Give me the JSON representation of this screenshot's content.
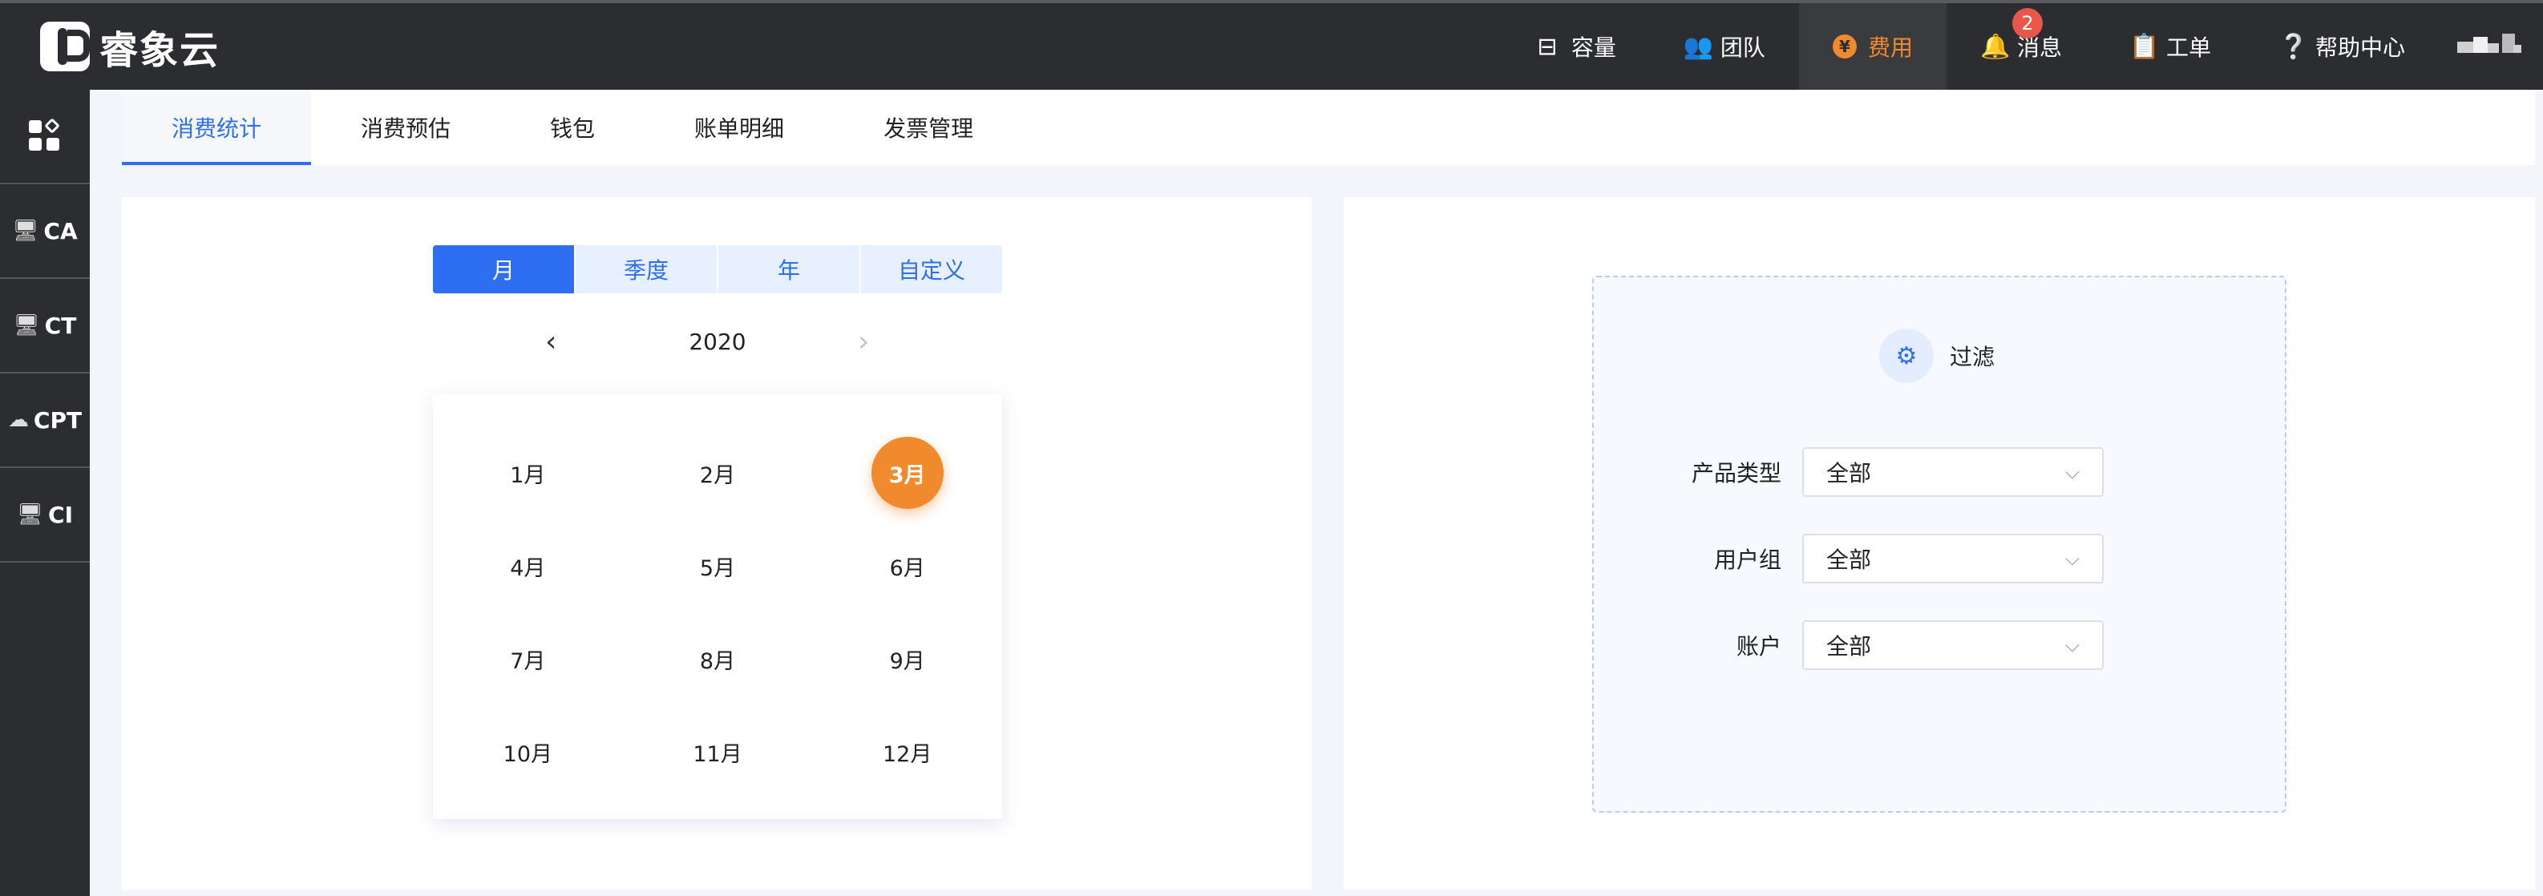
{
  "brand": {
    "name": "睿象云"
  },
  "topnav": {
    "items": [
      {
        "label": "容量",
        "icon": "inbox-icon"
      },
      {
        "label": "团队",
        "icon": "team-icon"
      },
      {
        "label": "费用",
        "icon": "yen-icon",
        "active": true
      },
      {
        "label": "消息",
        "icon": "bell-icon",
        "badge": "2"
      },
      {
        "label": "工单",
        "icon": "clipboard-icon"
      },
      {
        "label": "帮助中心",
        "icon": "help-icon"
      }
    ],
    "yen_glyph": "¥"
  },
  "sidebar": {
    "items": [
      {
        "label": "",
        "icon": "apps-grid-icon"
      },
      {
        "label": "CA",
        "icon": "monitor-icon"
      },
      {
        "label": "CT",
        "icon": "monitor-icon"
      },
      {
        "label": "CPT",
        "icon": "cloud-icon"
      },
      {
        "label": "CI",
        "icon": "monitor-icon"
      }
    ]
  },
  "tabs": [
    {
      "label": "消费统计",
      "active": true
    },
    {
      "label": "消费预估"
    },
    {
      "label": "钱包"
    },
    {
      "label": "账单明细"
    },
    {
      "label": "发票管理"
    }
  ],
  "period": {
    "options": [
      "月",
      "季度",
      "年",
      "自定义"
    ],
    "selected": "月",
    "year": "2020",
    "prev_glyph": "‹",
    "next_glyph": "›"
  },
  "months": {
    "cells": [
      "1月",
      "2月",
      "3月",
      "4月",
      "5月",
      "6月",
      "7月",
      "8月",
      "9月",
      "10月",
      "11月",
      "12月"
    ],
    "selected": "3月"
  },
  "filter": {
    "title": "过滤",
    "rows": [
      {
        "label": "产品类型",
        "value": "全部"
      },
      {
        "label": "用户组",
        "value": "全部"
      },
      {
        "label": "账户",
        "value": "全部"
      }
    ]
  },
  "colors": {
    "accent": "#2d6ff0",
    "selected_month": "#f08a2c",
    "topbar": "#2c2d30",
    "badge": "#e8574a"
  }
}
